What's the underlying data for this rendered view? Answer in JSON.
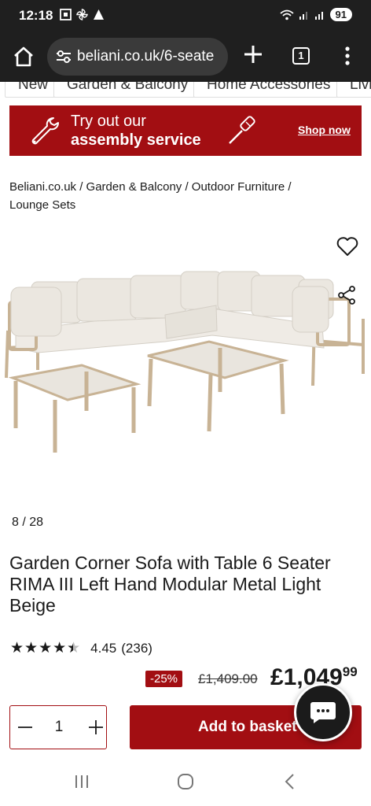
{
  "status_bar": {
    "time": "12:18",
    "left_icons": [
      "screenshot-icon",
      "pinwheel-icon",
      "warning-icon"
    ],
    "right_icons": [
      "wifi-icon",
      "signal-icon",
      "signal-icon"
    ],
    "battery": "91"
  },
  "browser": {
    "url": "beliani.co.uk/6-seate",
    "tab_count": "1"
  },
  "category_nav": {
    "items": [
      "New",
      "Garden & Balcony",
      "Home Accessories",
      "Livi"
    ]
  },
  "banner": {
    "line1": "Try out our",
    "line2": "assembly service",
    "link": "Shop now",
    "color": "#a20e12"
  },
  "breadcrumb": "Beliani.co.uk / Garden & Balcony / Outdoor Furniture / Lounge Sets",
  "gallery": {
    "counter": "8 / 28"
  },
  "product": {
    "title": "Garden Corner Sofa with Table 6 Seater RIMA III Left Hand Modular Metal Light Beige",
    "rating_value": "4.45",
    "rating_fraction": 0.89,
    "rating_count": "(236)",
    "discount": "-25%",
    "old_price": "£1,409.00",
    "price_main": "£1,049",
    "price_pence": "99"
  },
  "purchase": {
    "quantity": "1",
    "add_label": "Add to basket"
  },
  "android_nav": [
    "recent-apps-icon",
    "home-icon",
    "back-icon"
  ]
}
